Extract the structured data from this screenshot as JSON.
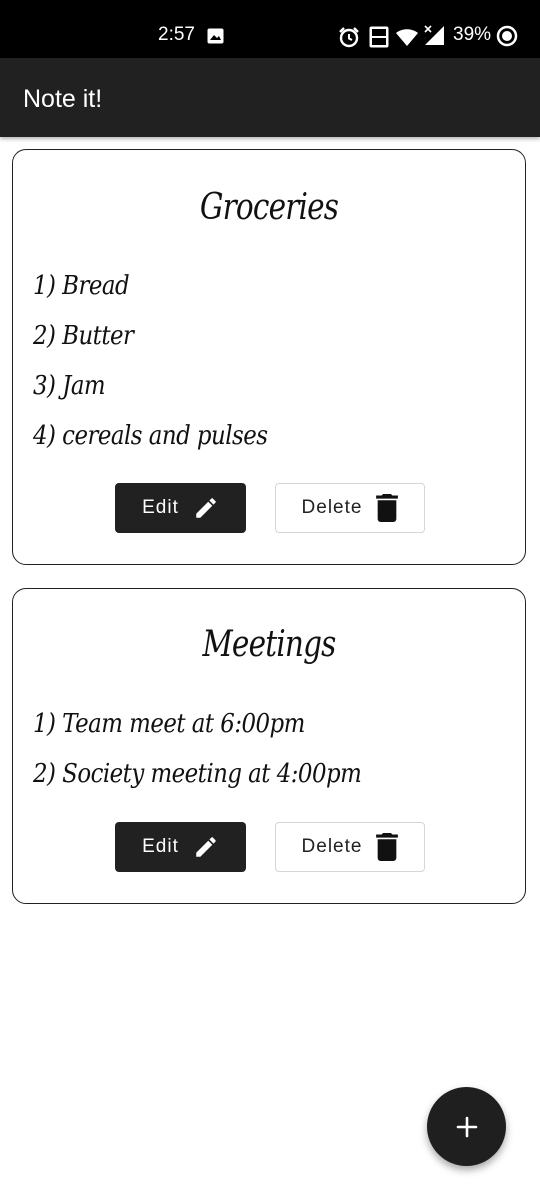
{
  "status_bar": {
    "time": "2:57",
    "battery": "39%",
    "icons": [
      "image-icon",
      "alarm-icon",
      "volte-icon",
      "wifi-icon",
      "signal-icon",
      "battery-icon"
    ]
  },
  "app_bar": {
    "title": "Note it!"
  },
  "notes": [
    {
      "title": "Groceries",
      "lines": [
        "1) Bread",
        "2) Butter",
        "3) Jam",
        "4) cereals and pulses"
      ],
      "edit_label": "Edit",
      "delete_label": "Delete"
    },
    {
      "title": "Meetings",
      "lines": [
        "1) Team meet at 6:00pm",
        "2) Society meeting at 4:00pm"
      ],
      "edit_label": "Edit",
      "delete_label": "Delete"
    }
  ],
  "fab": {
    "icon": "plus-icon"
  },
  "colors": {
    "app_bar": "#212121",
    "status_bar": "#000000",
    "button_dark": "#212121",
    "card_border": "#222222"
  }
}
